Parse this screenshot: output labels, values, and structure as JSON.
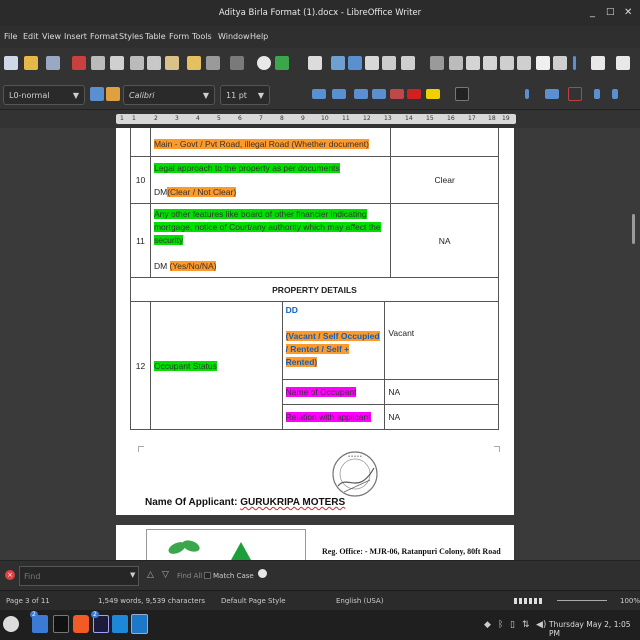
{
  "window": {
    "title": "Aditya Birla Format (1).docx - LibreOffice Writer",
    "min_glyph": "_",
    "max_glyph": "□",
    "close_glyph": "✕"
  },
  "menu": [
    "File",
    "Edit",
    "View",
    "Insert",
    "Format",
    "Styles",
    "Table",
    "Form",
    "Tools",
    "Window",
    "Help"
  ],
  "formatting": {
    "paragraph_style": "L0-normal",
    "font_name": "Calibri",
    "font_size": "11 pt"
  },
  "ruler_ticks": [
    "1",
    "1",
    "2",
    "3",
    "4",
    "5",
    "6",
    "7",
    "8",
    "9",
    "10",
    "11",
    "12",
    "13",
    "14",
    "15",
    "16",
    "17",
    "18",
    "19"
  ],
  "document": {
    "partial_row_text": "Main - Govt / Pvt Road, illegal Road (Whether document)",
    "rows": [
      {
        "num": "10",
        "question": "Legal approach to the property as per documents",
        "dm_prefix": "DM",
        "dm_option": "(Clear / Not Clear)",
        "value": "Clear"
      },
      {
        "num": "11",
        "question": "Any other features like board of other financier indicating mortgage, notice of Court/any authority which may affect the security",
        "dm_prefix": "DM ",
        "dm_option": "(Yes/No/NA)",
        "value": "NA"
      }
    ],
    "section_header": "PROPERTY DETAILS",
    "occupant": {
      "num": "12",
      "label": "Occupant Status",
      "dd": "DD",
      "dd_options": "(Vacant / Self Occupied / Rented / Self + Rented)",
      "status_value": "Vacant",
      "name_label": "Name of Occupant",
      "name_value": "NA",
      "relation_label": "Relation with applicant",
      "relation_value": "NA"
    },
    "applicant_label": "Name Of Applicant",
    "applicant_name": "GURUKRIPA MOTERS",
    "page2_header": "Reg. Office: - MJR-06, Ratanpuri Colony, 80ft Road"
  },
  "findbar": {
    "placeholder": "Find",
    "find_all": "Find All",
    "match_case": "Match Case"
  },
  "status": {
    "page": "Page 3 of 11",
    "words": "1,549 words, 9,539 characters",
    "page_style": "Default Page Style",
    "language": "English (USA)",
    "zoom": "100%"
  },
  "taskbar": {
    "clock": "Thursday May 2, 1:05 PM",
    "badge1": "2",
    "badge2": "2"
  },
  "colors": {
    "highlight_green": "#00e000",
    "highlight_orange": "#ff9a2a",
    "highlight_magenta": "#ff00ff",
    "dd_blue": "#1060c0"
  }
}
